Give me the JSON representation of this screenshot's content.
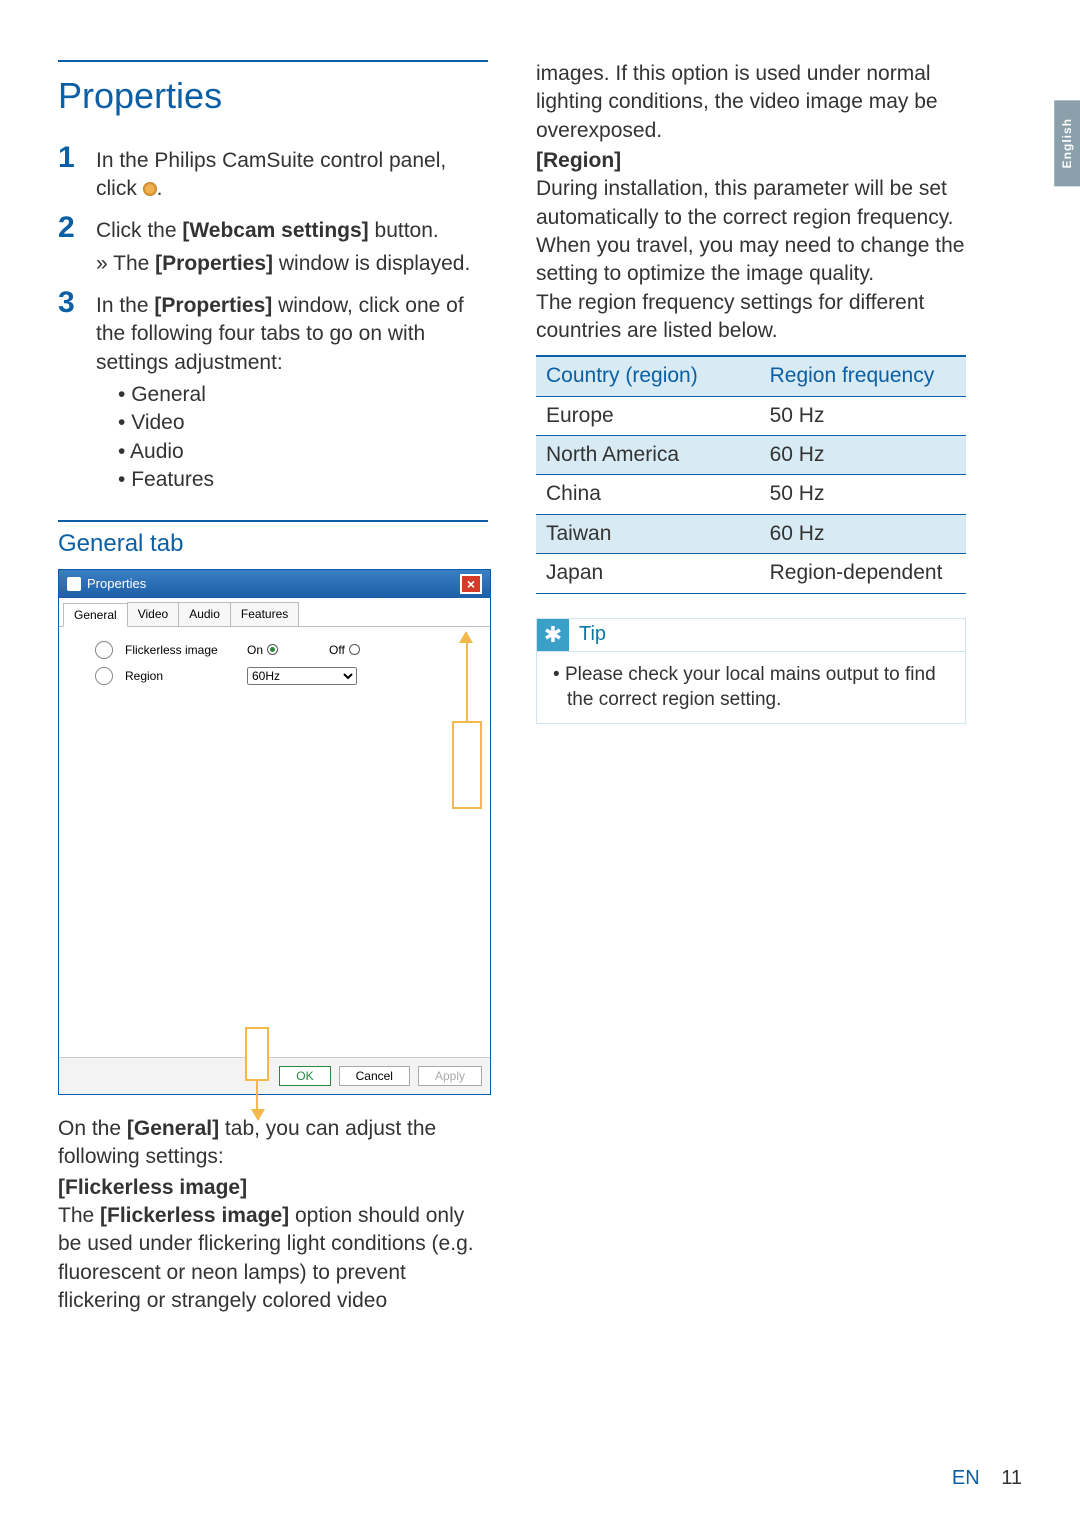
{
  "lang_tab": "English",
  "title": "Properties",
  "steps": [
    {
      "text_before": "In the Philips CamSuite control panel, click ",
      "icon_after_period": "."
    },
    {
      "text_before": "Click the ",
      "bold1": "[Webcam settings]",
      "text_after": " button.",
      "sub_before": "The ",
      "sub_bold": "[Properties]",
      "sub_after": " window is displayed."
    },
    {
      "text_before": "In the ",
      "bold1": "[Properties]",
      "text_after": " window, click one of the following four tabs to go on with settings adjustment:",
      "bullets": [
        "General",
        "Video",
        "Audio",
        "Features"
      ]
    }
  ],
  "general_tab_heading": "General tab",
  "dialog": {
    "title": "Properties",
    "tabs": [
      "General",
      "Video",
      "Audio",
      "Features"
    ],
    "flicker_label": "Flickerless image",
    "on_label": "On",
    "off_label": "Off",
    "region_label": "Region",
    "region_value": "60Hz",
    "ok": "OK",
    "cancel": "Cancel",
    "apply": "Apply"
  },
  "below_dialog": {
    "intro_before": "On the ",
    "intro_bold": "[General]",
    "intro_after": " tab, you can adjust the following settings:",
    "flicker_head": "[Flickerless image]",
    "flicker_body_before": "The ",
    "flicker_body_bold": "[Flickerless image]",
    "flicker_body_after": " option should only be used under flickering light conditions (e.g. fluorescent or neon lamps) to prevent flickering or strangely colored video"
  },
  "right": {
    "cont": "images. If this option is used under normal lighting conditions, the video image may be overexposed.",
    "region_head": "[Region]",
    "region_p1": "During installation, this parameter will be set automatically to the correct region frequency. When you travel, you may need to change the setting to optimize the image quality.",
    "region_p2": "The region frequency settings for different countries are listed below.",
    "table_headers": [
      "Country (region)",
      "Region frequency"
    ],
    "table_rows": [
      [
        "Europe",
        "50 Hz"
      ],
      [
        "North America",
        "60 Hz"
      ],
      [
        "China",
        "50 Hz"
      ],
      [
        "Taiwan",
        "60 Hz"
      ],
      [
        "Japan",
        "Region-dependent"
      ]
    ]
  },
  "tip": {
    "label": "Tip",
    "body": "Please check your local mains output to find the correct region setting."
  },
  "footer": {
    "lang": "EN",
    "page": "11"
  }
}
